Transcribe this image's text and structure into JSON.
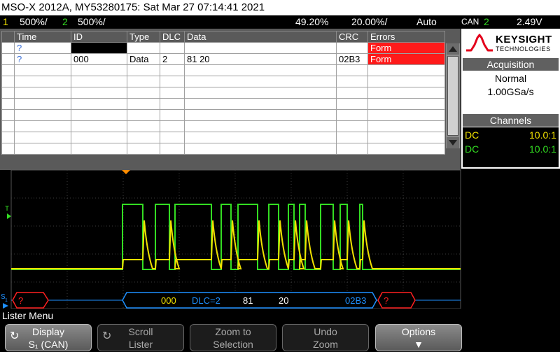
{
  "title_bar": "MSO-X 2012A, MY53280175: Sat Mar 27 07:14:41 2021",
  "status": {
    "ch1_num": "1",
    "ch1_scale": "500%/",
    "ch2_num": "2",
    "ch2_scale": "500%/",
    "time_scale": "49.20%",
    "trigger_delay": "20.00%/",
    "trigger_mode": "Auto",
    "trigger_source": "CAN",
    "trigger_channel": "2",
    "trigger_level": "2.49V"
  },
  "lister": {
    "columns": [
      "Time",
      "ID",
      "Type",
      "DLC",
      "Data",
      "CRC",
      "Errors"
    ],
    "rows": [
      {
        "time": "?",
        "id": "",
        "type": "",
        "dlc": "",
        "data": "",
        "crc": "",
        "errors": "Form"
      },
      {
        "time": "?",
        "id": "000",
        "type": "Data",
        "dlc": "2",
        "data": "81  20",
        "crc": "02B3",
        "errors": "Form"
      }
    ]
  },
  "right_panel": {
    "brand_line1": "KEYSIGHT",
    "brand_line2": "TECHNOLOGIES",
    "acquisition_title": "Acquisition",
    "acquisition_mode": "Normal",
    "sample_rate": "1.00GSa/s",
    "channels_title": "Channels",
    "ch1_coupling": "DC",
    "ch1_probe": "10.0:1",
    "ch2_coupling": "DC",
    "ch2_probe": "10.0:1"
  },
  "scope": {
    "trigger_marker": "T",
    "serial_marker": "S",
    "serial_marker_sub": "1",
    "decode": {
      "error1": "?",
      "id": "000",
      "dlc": "DLC=2",
      "byte1": "81",
      "byte2": "20",
      "crc": "02B3",
      "error2": "?"
    },
    "colors": {
      "ch1": "#f0e000",
      "ch2": "#33dd22",
      "decode": "#1e90ff",
      "error": "#ff2020",
      "trigger": "#ff8c00"
    }
  },
  "menu": {
    "title": "Lister Menu",
    "softkeys": [
      {
        "line1": "Display",
        "line2": "S₁ (CAN)"
      },
      {
        "line1": "Scroll",
        "line2": "Lister"
      },
      {
        "line1": "Zoom to",
        "line2": "Selection"
      },
      {
        "line1": "Undo",
        "line2": "Zoom"
      },
      {
        "line1": "Options",
        "line2": "▼"
      }
    ]
  }
}
